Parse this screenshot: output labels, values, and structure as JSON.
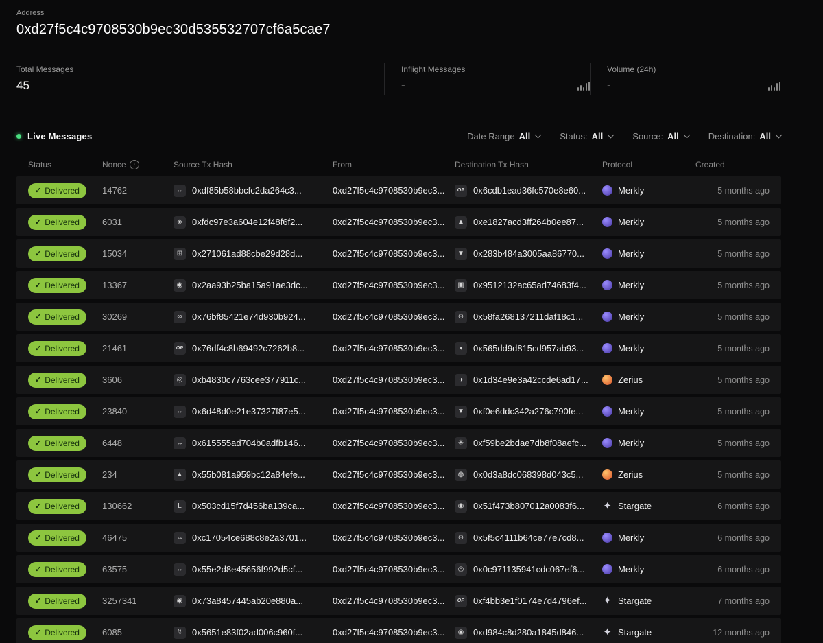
{
  "icon_glyphs": {
    "check": "✓",
    "info": "i",
    "arrows": "↔",
    "diamond": "◈",
    "grid": "⊞",
    "orb": "◉",
    "loop": "∞",
    "op": "OP",
    "ring": "◎",
    "triangle": "▲",
    "shield": "▼",
    "cee": "◖",
    "moon": "◑",
    "dash": "⊖",
    "square": "▣",
    "asterisk": "✳",
    "globe": "◍",
    "el": "L",
    "bolt": "↯",
    "star": "✦"
  },
  "colors": {
    "page_bg": "#0a0a0b",
    "row_bg": "#161617",
    "status_green": "#8dc63f",
    "live_dot_green": "#4ade80"
  },
  "header": {
    "address_label": "Address",
    "address": "0xd27f5c4c9708530b9ec30d535532707cf6a5cae7"
  },
  "stats": [
    {
      "label": "Total Messages",
      "value": "45",
      "has_chart": false
    },
    {
      "label": "Inflight Messages",
      "value": "-",
      "has_chart": true
    },
    {
      "label": "Volume (24h)",
      "value": "-",
      "has_chart": true
    }
  ],
  "live_section": {
    "title": "Live Messages",
    "filters": [
      {
        "label": "Date Range",
        "value": "All"
      },
      {
        "label": "Status:",
        "value": "All"
      },
      {
        "label": "Source:",
        "value": "All"
      },
      {
        "label": "Destination:",
        "value": "All"
      }
    ]
  },
  "protocols": {
    "Merkly": {
      "style": "circle",
      "c1": "#9b8cff",
      "c2": "#4636a3"
    },
    "Zerius": {
      "style": "circle",
      "c1": "#ffc36b",
      "c2": "#d9502a"
    },
    "Stargate": {
      "style": "star",
      "color": "#d4d4de"
    }
  },
  "table": {
    "columns": [
      "Status",
      "Nonce",
      "Source Tx Hash",
      "From",
      "Destination Tx Hash",
      "Protocol",
      "Created"
    ],
    "rows": [
      {
        "status": "Delivered",
        "nonce": "14762",
        "source_icon": "arrows",
        "source_tx": "0xdf85b58bbcfc2da264c3...",
        "from": "0xd27f5c4c9708530b9ec3...",
        "dest_icon": "op",
        "dest_tx": "0x6cdb1ead36fc570e8e60...",
        "protocol": "Merkly",
        "created": "5 months ago"
      },
      {
        "status": "Delivered",
        "nonce": "6031",
        "source_icon": "diamond",
        "source_tx": "0xfdc97e3a604e12f48f6f2...",
        "from": "0xd27f5c4c9708530b9ec3...",
        "dest_icon": "triangle",
        "dest_tx": "0xe1827acd3ff264b0ee87...",
        "protocol": "Merkly",
        "created": "5 months ago"
      },
      {
        "status": "Delivered",
        "nonce": "15034",
        "source_icon": "grid",
        "source_tx": "0x271061ad88cbe29d28d...",
        "from": "0xd27f5c4c9708530b9ec3...",
        "dest_icon": "shield",
        "dest_tx": "0x283b484a3005aa86770...",
        "protocol": "Merkly",
        "created": "5 months ago"
      },
      {
        "status": "Delivered",
        "nonce": "13367",
        "source_icon": "orb",
        "source_tx": "0x2aa93b25ba15a91ae3dc...",
        "from": "0xd27f5c4c9708530b9ec3...",
        "dest_icon": "square",
        "dest_tx": "0x9512132ac65ad74683f4...",
        "protocol": "Merkly",
        "created": "5 months ago"
      },
      {
        "status": "Delivered",
        "nonce": "30269",
        "source_icon": "loop",
        "source_tx": "0x76bf85421e74d930b924...",
        "from": "0xd27f5c4c9708530b9ec3...",
        "dest_icon": "dash",
        "dest_tx": "0x58fa268137211daf18c1...",
        "protocol": "Merkly",
        "created": "5 months ago"
      },
      {
        "status": "Delivered",
        "nonce": "21461",
        "source_icon": "op",
        "source_tx": "0x76df4c8b69492c7262b8...",
        "from": "0xd27f5c4c9708530b9ec3...",
        "dest_icon": "cee",
        "dest_tx": "0x565dd9d815cd957ab93...",
        "protocol": "Merkly",
        "created": "5 months ago"
      },
      {
        "status": "Delivered",
        "nonce": "3606",
        "source_icon": "ring",
        "source_tx": "0xb4830c7763cee377911c...",
        "from": "0xd27f5c4c9708530b9ec3...",
        "dest_icon": "moon",
        "dest_tx": "0x1d34e9e3a42ccde6ad17...",
        "protocol": "Zerius",
        "created": "5 months ago"
      },
      {
        "status": "Delivered",
        "nonce": "23840",
        "source_icon": "arrows",
        "source_tx": "0x6d48d0e21e37327f87e5...",
        "from": "0xd27f5c4c9708530b9ec3...",
        "dest_icon": "shield",
        "dest_tx": "0xf0e6ddc342a276c790fe...",
        "protocol": "Merkly",
        "created": "5 months ago"
      },
      {
        "status": "Delivered",
        "nonce": "6448",
        "source_icon": "arrows",
        "source_tx": "0x615555ad704b0adfb146...",
        "from": "0xd27f5c4c9708530b9ec3...",
        "dest_icon": "asterisk",
        "dest_tx": "0xf59be2bdae7db8f08aefc...",
        "protocol": "Merkly",
        "created": "5 months ago"
      },
      {
        "status": "Delivered",
        "nonce": "234",
        "source_icon": "triangle",
        "source_tx": "0x55b081a959bc12a84efe...",
        "from": "0xd27f5c4c9708530b9ec3...",
        "dest_icon": "globe",
        "dest_tx": "0x0d3a8dc068398d043c5...",
        "protocol": "Zerius",
        "created": "5 months ago"
      },
      {
        "status": "Delivered",
        "nonce": "130662",
        "source_icon": "el",
        "source_tx": "0x503cd15f7d456ba139ca...",
        "from": "0xd27f5c4c9708530b9ec3...",
        "dest_icon": "orb",
        "dest_tx": "0x51f473b807012a0083f6...",
        "protocol": "Stargate",
        "created": "6 months ago"
      },
      {
        "status": "Delivered",
        "nonce": "46475",
        "source_icon": "arrows",
        "source_tx": "0xc17054ce688c8e2a3701...",
        "from": "0xd27f5c4c9708530b9ec3...",
        "dest_icon": "dash",
        "dest_tx": "0x5f5c4111b64ce77e7cd8...",
        "protocol": "Merkly",
        "created": "6 months ago"
      },
      {
        "status": "Delivered",
        "nonce": "63575",
        "source_icon": "arrows",
        "source_tx": "0x55e2d8e45656f992d5cf...",
        "from": "0xd27f5c4c9708530b9ec3...",
        "dest_icon": "ring",
        "dest_tx": "0x0c971135941cdc067ef6...",
        "protocol": "Merkly",
        "created": "6 months ago"
      },
      {
        "status": "Delivered",
        "nonce": "3257341",
        "source_icon": "orb",
        "source_tx": "0x73a8457445ab20e880a...",
        "from": "0xd27f5c4c9708530b9ec3...",
        "dest_icon": "op",
        "dest_tx": "0xf4bb3e1f0174e7d4796ef...",
        "protocol": "Stargate",
        "created": "7 months ago"
      },
      {
        "status": "Delivered",
        "nonce": "6085",
        "source_icon": "bolt",
        "source_tx": "0x5651e83f02ad006c960f...",
        "from": "0xd27f5c4c9708530b9ec3...",
        "dest_icon": "orb",
        "dest_tx": "0xd984c8d280a1845d846...",
        "protocol": "Stargate",
        "created": "12 months ago"
      }
    ]
  }
}
